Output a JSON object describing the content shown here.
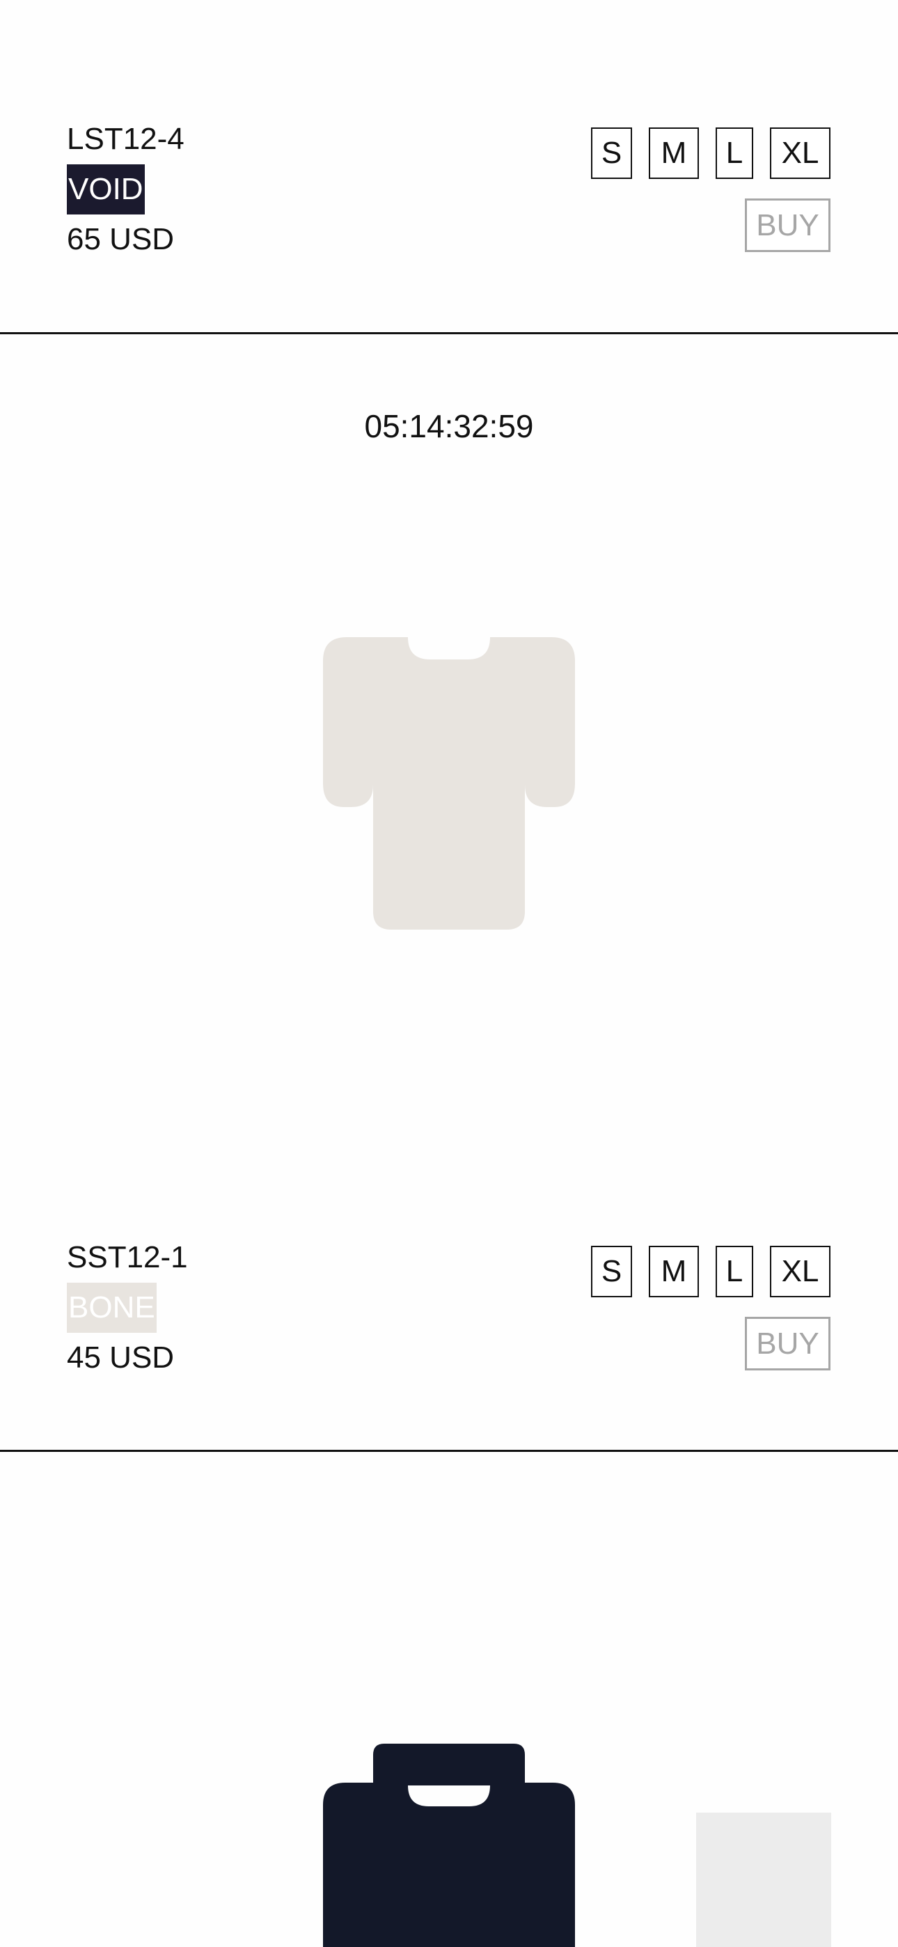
{
  "products": [
    {
      "code": "LST12-4",
      "color_name": "VOID",
      "price": "65 USD",
      "sizes": [
        "S",
        "M",
        "L",
        "XL"
      ],
      "buy_label": "BUY",
      "tag_bg": "#1b1a2e",
      "tag_fg": "#ffffff"
    },
    {
      "countdown": "05:14:32:59",
      "code": "SST12-1",
      "color_name": "BONE",
      "price": "45 USD",
      "sizes": [
        "S",
        "M",
        "L",
        "XL"
      ],
      "buy_label": "BUY",
      "tag_bg": "#e8e4df",
      "tag_fg": "#ffffff",
      "garment_color": "#e8e4df",
      "garment_icon": "short-sleeve-tshirt-icon"
    },
    {
      "garment_color": "#131829",
      "garment_icon": "long-sleeve-shirt-icon"
    }
  ],
  "colors": {
    "text": "#111111",
    "buy_border": "#a6a6a6",
    "thumb": "#ececec"
  }
}
